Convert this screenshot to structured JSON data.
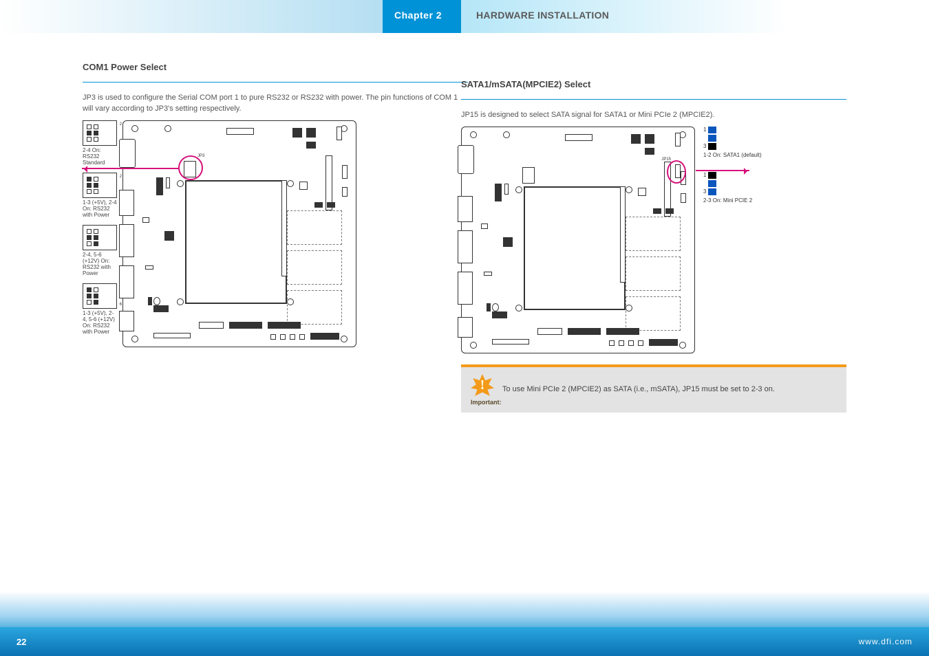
{
  "header": {
    "chapter": "Chapter 2",
    "title": "HARDWARE INSTALLATION"
  },
  "left_section": {
    "heading": "COM1 Power Select",
    "desc": "JP3 is used to configure the Serial COM port 1 to pure RS232 or RS232 with power. The pin functions of COM 1 will vary according to JP3's setting respectively.",
    "jumper_options": [
      {
        "label": "2-4 On: RS232 Standard",
        "pin1": true,
        "default": true
      },
      {
        "label": "1-3 (+5V), 2-4 On: RS232 with Power",
        "pin1": true
      },
      {
        "label": "2-4, 5-6 (+12V) On: RS232 with Power",
        "pin1": true
      },
      {
        "label": "1-3 (+5V), 2-4, 5-6 (+12V) On: RS232 with Power",
        "pin1": true
      }
    ],
    "board_label": "JP3"
  },
  "right_section": {
    "heading": "SATA1/mSATA(MPCIE2) Select",
    "desc": "JP15 is designed to select SATA signal for SATA1 or Mini PCIe 2 (MPCIE2).",
    "jumper_options": [
      {
        "label": "1-2 On: SATA1 (default)",
        "pins": [
          1,
          2,
          3
        ],
        "on": [
          1,
          2
        ]
      },
      {
        "label": "2-3 On: Mini PCIE 2",
        "pins": [
          1,
          2,
          3
        ],
        "on": [
          2,
          3
        ]
      }
    ],
    "note_label": "Important:",
    "note_text": "To use Mini PCIe 2 (MPCIE2) as SATA (i.e., mSATA), JP15 must be set to 2-3 on.",
    "board_label": "JP15"
  },
  "footer": {
    "page": "22",
    "brand": "www.dfi.com"
  }
}
